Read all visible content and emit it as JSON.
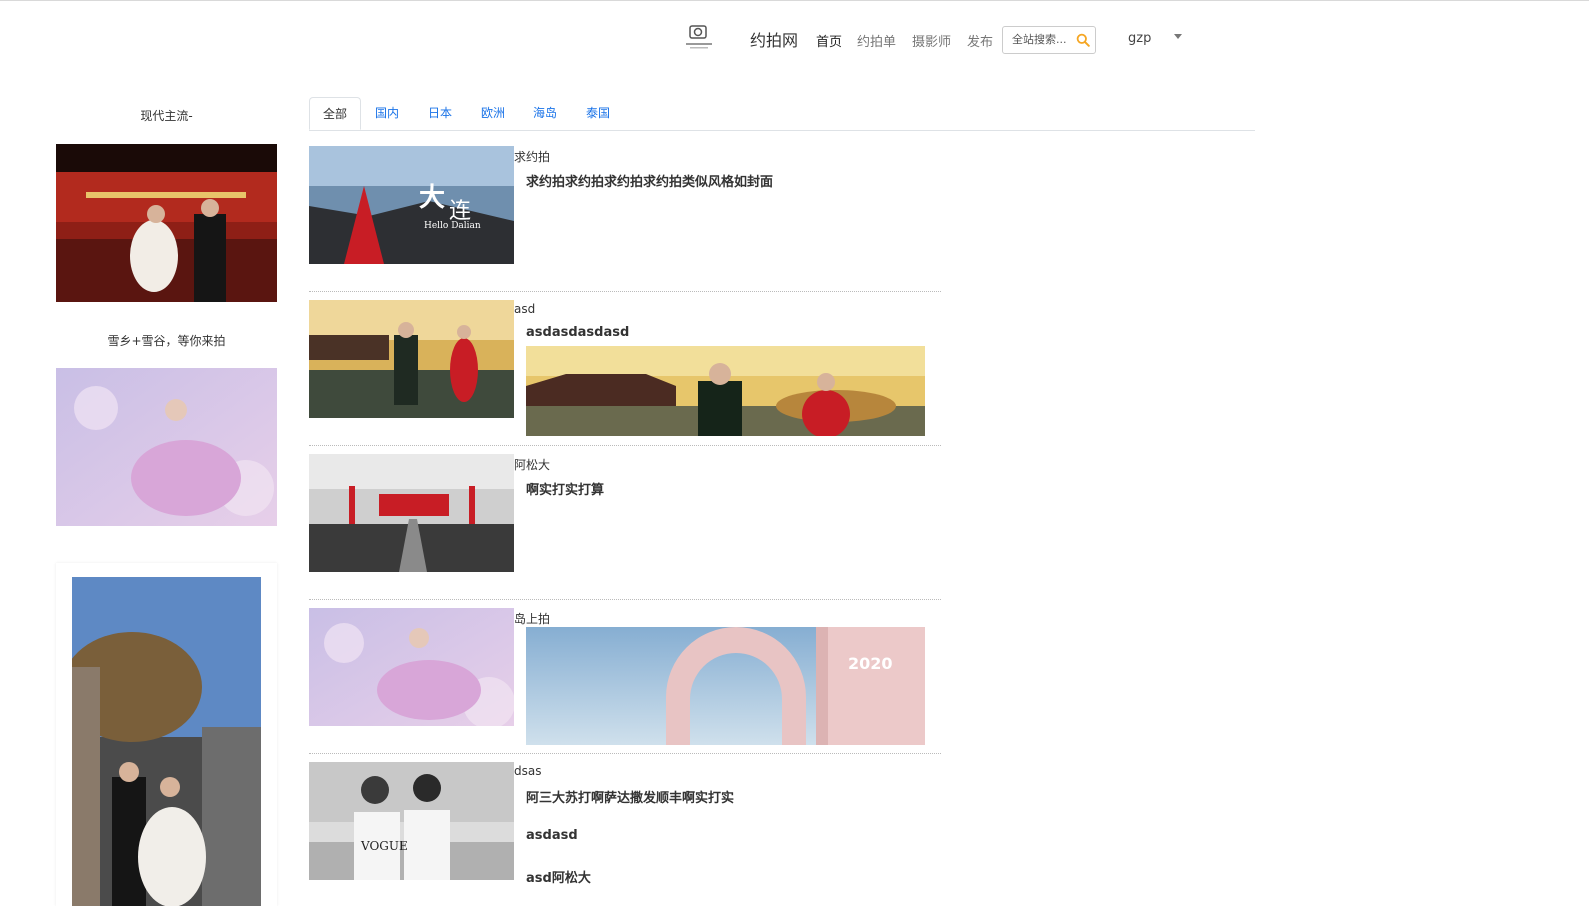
{
  "header": {
    "brand": "约拍网",
    "logo_icon": "camera-icon",
    "nav": [
      "首页",
      "约拍单",
      "摄影师",
      "发布"
    ],
    "search_placeholder": "全站搜索...",
    "search_icon": "search-icon",
    "user_name": "gzp",
    "accent_color": "#f5a623"
  },
  "sidebar": {
    "items": [
      {
        "title": "现代主流-"
      },
      {
        "title": "雪乡+雪谷，等你来拍"
      },
      {
        "title": ""
      }
    ]
  },
  "tabs": [
    "全部",
    "国内",
    "日本",
    "欧洲",
    "海岛",
    "泰国"
  ],
  "active_tab": "全部",
  "posts": [
    {
      "category": "求约拍",
      "title": "求约拍求约拍求约拍求约拍类似风格如封面",
      "extra_lines": []
    },
    {
      "category": "asd",
      "title": "asdasdasdasd",
      "extra_lines": []
    },
    {
      "category": "阿松大",
      "title": "啊实打实打算",
      "extra_lines": []
    },
    {
      "category": "岛上拍",
      "title": "",
      "extra_lines": []
    },
    {
      "category": "dsas",
      "title": "阿三大苏打啊萨达撒发顺丰啊实打实",
      "extra_lines": [
        "asdasd",
        "asd阿松大"
      ]
    }
  ],
  "colors": {
    "link": "#1a73e8",
    "divider": "#bbbbbb"
  }
}
